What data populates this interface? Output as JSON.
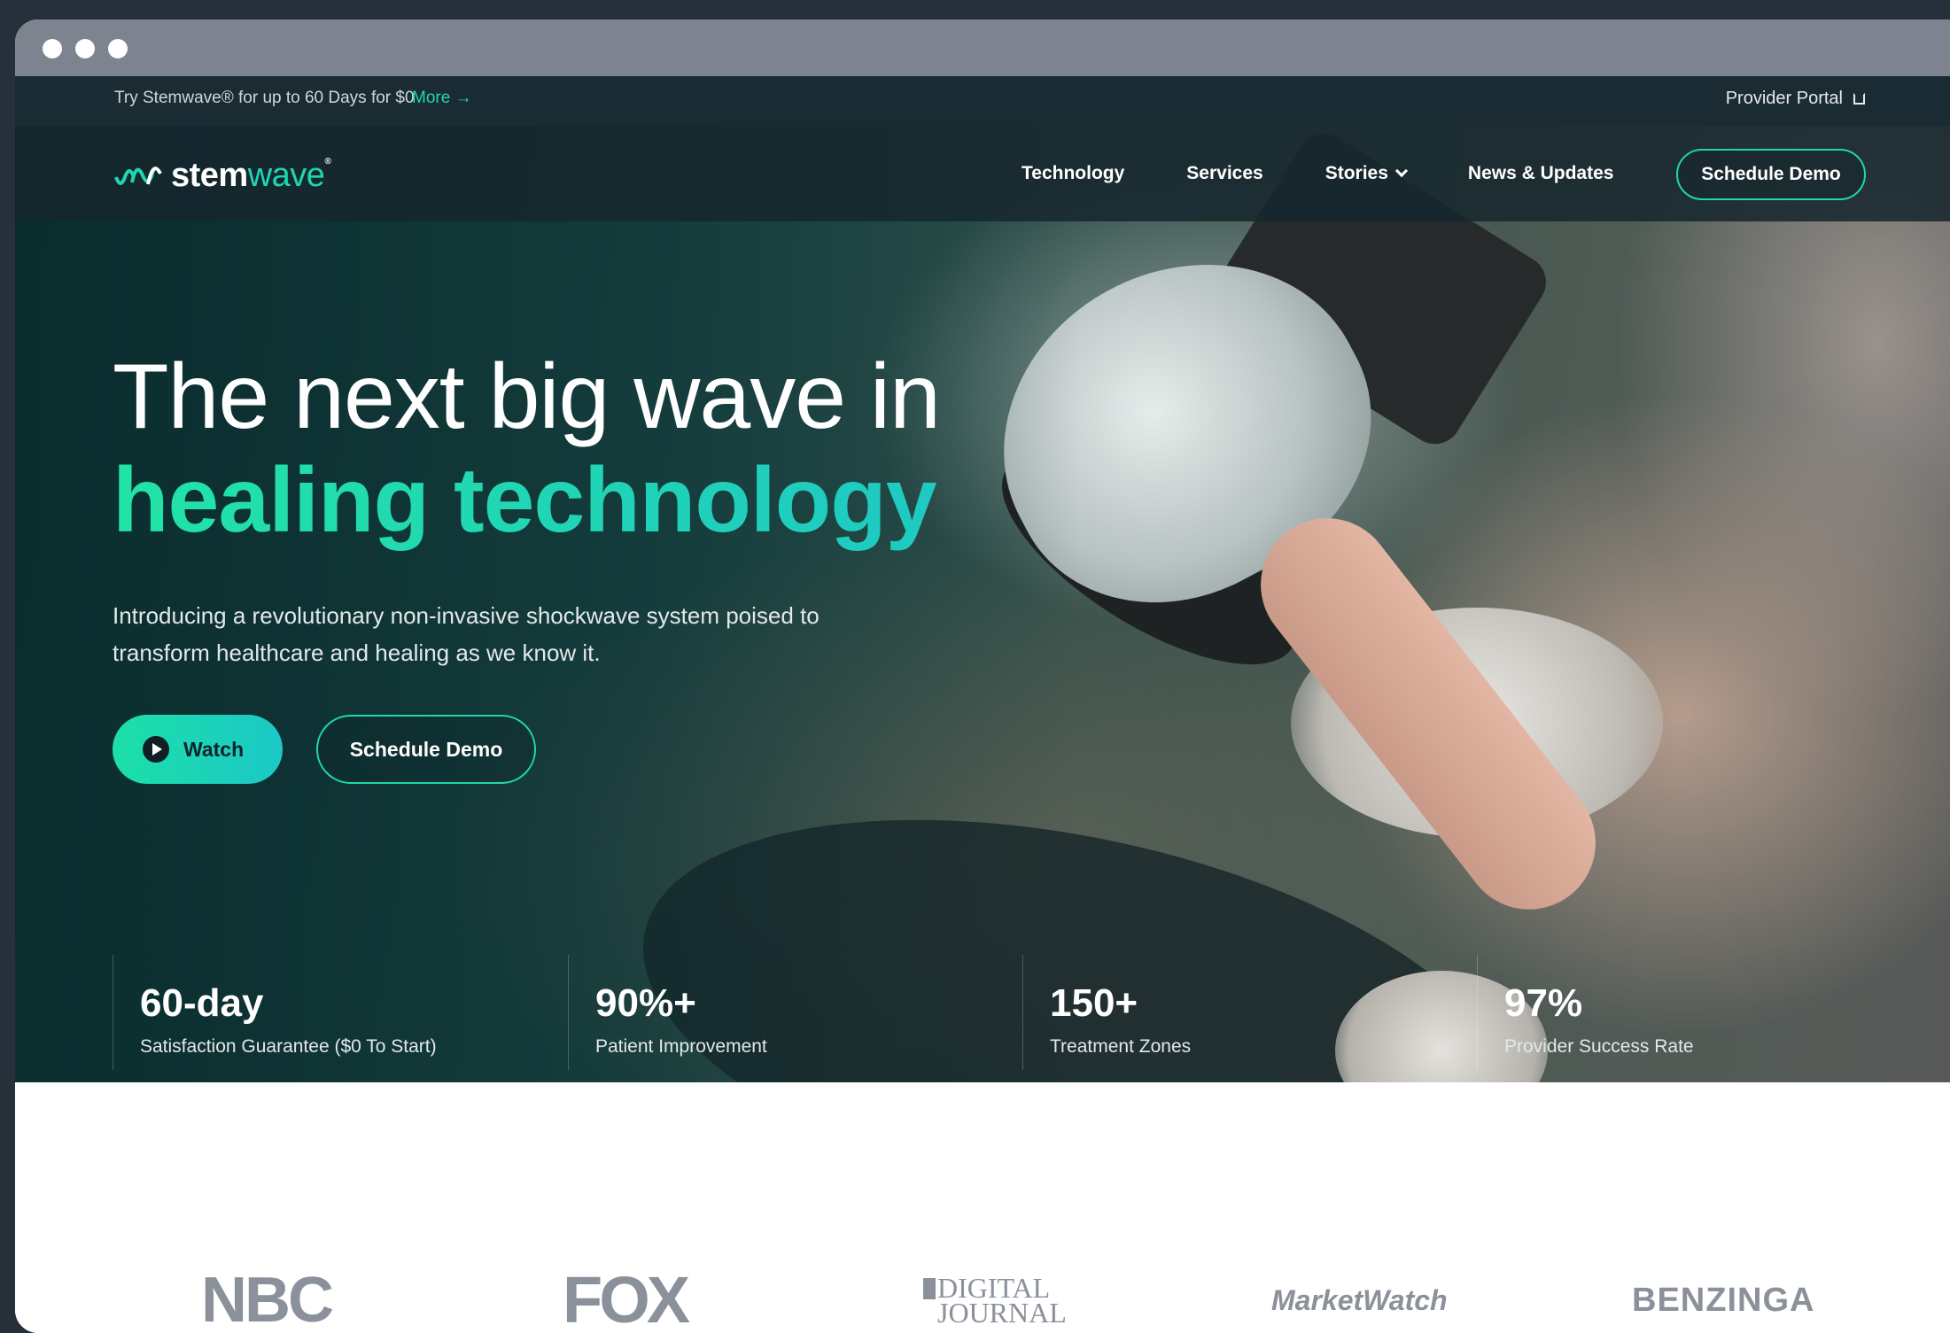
{
  "announcement": {
    "text": "Try Stemwave® for up to 60 Days for $0",
    "more_label": "More →"
  },
  "header": {
    "provider_portal": "Provider Portal",
    "logo_main": "stem",
    "logo_accent": "wave",
    "logo_tm": "®",
    "nav": [
      {
        "label": "Technology"
      },
      {
        "label": "Services"
      },
      {
        "label": "Stories"
      },
      {
        "label": "News & Updates"
      }
    ],
    "cta_label": "Schedule Demo"
  },
  "hero": {
    "headline": "The next big wave in",
    "headline_accent": "healing technology",
    "subcopy": "Introducing a revolutionary non-invasive shockwave system poised to transform healthcare and healing as we know it.",
    "watch_label": "Watch",
    "demo_label": "Schedule Demo"
  },
  "stats": [
    {
      "value": "60-day",
      "label": "Satisfaction Guarantee ($0 To Start)"
    },
    {
      "value": "90%+",
      "label": "Patient Improvement"
    },
    {
      "value": "150+",
      "label": "Treatment Zones"
    },
    {
      "value": "97%",
      "label": "Provider Success Rate"
    }
  ],
  "press": {
    "nbc": "NBC",
    "fox": "FOX",
    "digital_journal_line1": "DIGITAL",
    "digital_journal_line2": "JOURNAL",
    "marketwatch": "MarketWatch",
    "benzinga": "BENZINGA"
  },
  "colors": {
    "accent": "#1fd6b0",
    "navbar": "#16262d",
    "chrome": "#7d848f"
  },
  "icons": [
    "window-dot-icon",
    "external-link-icon",
    "chevron-down-icon",
    "play-icon",
    "wave-logo-icon"
  ]
}
